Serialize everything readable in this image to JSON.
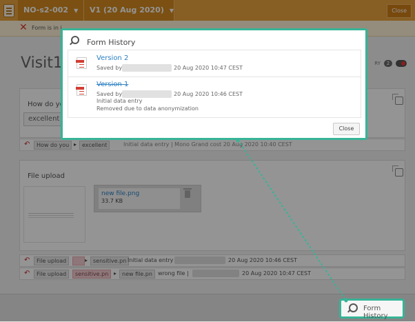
{
  "header": {
    "patient_id": "NO-s2-002",
    "visit": "V1 (20 Aug 2020)",
    "close_label": "Close"
  },
  "alert": {
    "text": "Form is in i"
  },
  "page": {
    "title": "Visit1",
    "badge_prefix": "RY",
    "badge_count": "2"
  },
  "question1": {
    "label": "How do yo",
    "answer": "excellent",
    "log": {
      "field": "How do you",
      "value": "excellent",
      "reason": "Initial data entry | Mono Grand cost 20 Aug 2020 10:40 CEST"
    }
  },
  "file_upload": {
    "label": "File upload",
    "file_name": "new file.png",
    "file_size": "33.7 KB"
  },
  "log_rows": [
    {
      "field": "File upload",
      "old": "",
      "new": "sensitive.pn",
      "reason": "Initial data entry |",
      "timestamp": "20 Aug 2020 10:46 CEST"
    },
    {
      "field": "File upload",
      "old": "sensitive.pn",
      "new": "new file.pn",
      "reason": "wrong file |",
      "timestamp": "20 Aug 2020 10:47 CEST"
    }
  ],
  "footer": {
    "form_history_label": "Form History"
  },
  "modal": {
    "title": "Form History",
    "versions": [
      {
        "name": "Version 2",
        "saved_by": "Saved by",
        "timestamp": "20 Aug 2020 10:47 CEST"
      },
      {
        "name": "Version 1",
        "saved_by": "Saved by",
        "timestamp": "20 Aug 2020 10:46 CEST",
        "note1": "Initial data entry",
        "note2": "Removed due to data anonymization"
      }
    ],
    "close_label": "Close"
  },
  "colors": {
    "accent": "#e8a33d",
    "highlight": "#36b497",
    "link": "#2a7fc2"
  }
}
